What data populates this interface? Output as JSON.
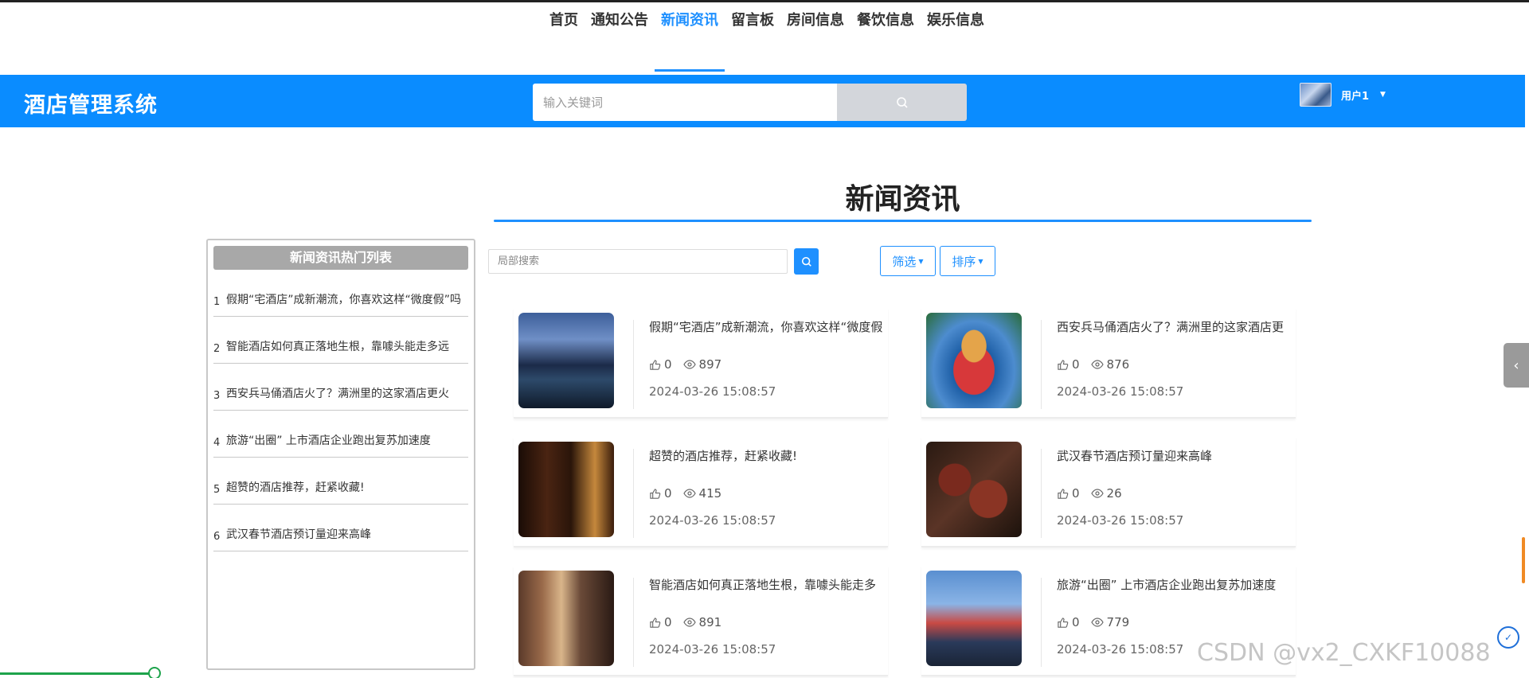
{
  "nav": {
    "items": [
      {
        "label": "首页"
      },
      {
        "label": "通知公告"
      },
      {
        "label": "新闻资讯"
      },
      {
        "label": "留言板"
      },
      {
        "label": "房间信息"
      },
      {
        "label": "餐饮信息"
      },
      {
        "label": "娱乐信息"
      }
    ],
    "active_index": 2
  },
  "header": {
    "title": "酒店管理系统",
    "search_placeholder": "输入关键词",
    "user_name": "用户1"
  },
  "page": {
    "title": "新闻资讯"
  },
  "sidebar": {
    "heading": "新闻资讯热门列表",
    "items": [
      {
        "index": "1",
        "title": "假期“宅酒店”成新潮流，你喜欢这样“微度假”吗"
      },
      {
        "index": "2",
        "title": "智能酒店如何真正落地生根，靠噱头能走多远"
      },
      {
        "index": "3",
        "title": "西安兵马俑酒店火了？满洲里的这家酒店更火"
      },
      {
        "index": "4",
        "title": "旅游“出圈” 上市酒店企业跑出复苏加速度"
      },
      {
        "index": "5",
        "title": "超赞的酒店推荐，赶紧收藏!"
      },
      {
        "index": "6",
        "title": "武汉春节酒店预订量迎来高峰"
      }
    ]
  },
  "toolbar": {
    "local_search_placeholder": "局部搜索",
    "filter_label": "筛选",
    "sort_label": "排序"
  },
  "cards": [
    {
      "title": "假期“宅酒店”成新潮流，你喜欢这样“微度假",
      "likes": "0",
      "views": "897",
      "date": "2024-03-26 15:08:57",
      "image": "hotel-lake-night"
    },
    {
      "title": "西安兵马俑酒店火了？满洲里的这家酒店更",
      "likes": "0",
      "views": "876",
      "date": "2024-03-26 15:08:57",
      "image": "matryoshka-hotel"
    },
    {
      "title": "超赞的酒店推荐，赶紧收藏!",
      "likes": "0",
      "views": "415",
      "date": "2024-03-26 15:08:57",
      "image": "restaurant-sign"
    },
    {
      "title": "武汉春节酒店预订量迎来高峰",
      "likes": "0",
      "views": "26",
      "date": "2024-03-26 15:08:57",
      "image": "cured-meat"
    },
    {
      "title": "智能酒店如何真正落地生根，靠噱头能走多",
      "likes": "0",
      "views": "891",
      "date": "2024-03-26 15:08:57",
      "image": "hotel-corridor"
    },
    {
      "title": "旅游“出圈” 上市酒店企业跑出复苏加速度",
      "likes": "0",
      "views": "779",
      "date": "2024-03-26 15:08:57",
      "image": "hotel-tower"
    }
  ],
  "side_tab": {
    "icon": "chevron-left-icon"
  },
  "watermark": "CSDN @vx2_CXKF10088",
  "colors": {
    "primary": "#0a8cff",
    "accent": "#1e90ff"
  }
}
